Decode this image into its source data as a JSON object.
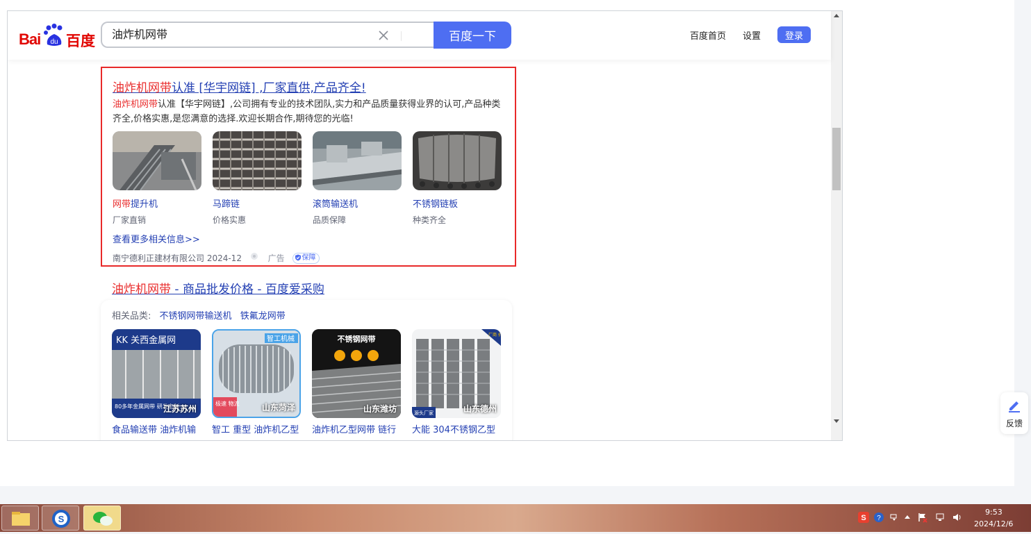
{
  "header": {
    "logo_text_left": "Bai",
    "logo_text_right": "百度",
    "logo_paw_text": "du",
    "search_value": "油炸机网带",
    "search_button": "百度一下",
    "nav_home": "百度首页",
    "nav_settings": "设置",
    "login": "登录"
  },
  "ad_result": {
    "title_highlight": "油炸机网带",
    "title_rest": "认准 [华宇网链] ,厂家直供,产品齐全!",
    "desc_highlight": "油炸机网带",
    "desc_rest": "认准【华宇网链】,公司拥有专业的技术团队,实力和产品质量获得业界的认可,产品种类齐全,价格实惠,是您满意的选择.欢迎长期合作,期待您的光临!",
    "items": [
      {
        "label_highlight": "网带",
        "label_rest": "提升机",
        "sub": "厂家直销"
      },
      {
        "label_highlight": "",
        "label_rest": "马蹄链",
        "sub": "价格实惠"
      },
      {
        "label_highlight": "",
        "label_rest": "滚筒输送机",
        "sub": "品质保障"
      },
      {
        "label_highlight": "",
        "label_rest": "不锈钢链板",
        "sub": "种类齐全"
      }
    ],
    "more_link": "查看更多相关信息>>",
    "source": "南宁德利正建材有限公司 2024-12",
    "ad_label": "广告",
    "guarantee": "保障"
  },
  "result2": {
    "title_highlight": "油炸机网带",
    "title_rest": " - 商品批发价格 - 百度爱采购",
    "related_label": "相关品类:",
    "related_tags": [
      "不锈钢网带输送机",
      "铁氟龙网带"
    ],
    "products": [
      {
        "banner": "KK 关西金属网",
        "tag": "80多年金属网带 研发定制",
        "location": "江苏苏州",
        "name": "食品输送带 油炸机输"
      },
      {
        "banner": "智工机械",
        "tag": "极速 物流",
        "location": "山东菏泽",
        "name": "智工 重型 油炸机乙型"
      },
      {
        "banner": "不锈钢网带",
        "tag": "",
        "location": "山东潍坊",
        "name": "油炸机乙型网带 链行"
      },
      {
        "banner": "厂商 价比",
        "tag": "源头厂家",
        "location": "山东德州",
        "name": "大能 304不锈钢乙型"
      }
    ]
  },
  "feedback": "反馈",
  "taskbar": {
    "time": "9:53",
    "date": "2024/12/6"
  },
  "colors": {
    "brand_blue": "#4e6ef2",
    "link_blue": "#2440b3",
    "highlight_red": "#e92e2e",
    "ad_border": "#e82929"
  }
}
